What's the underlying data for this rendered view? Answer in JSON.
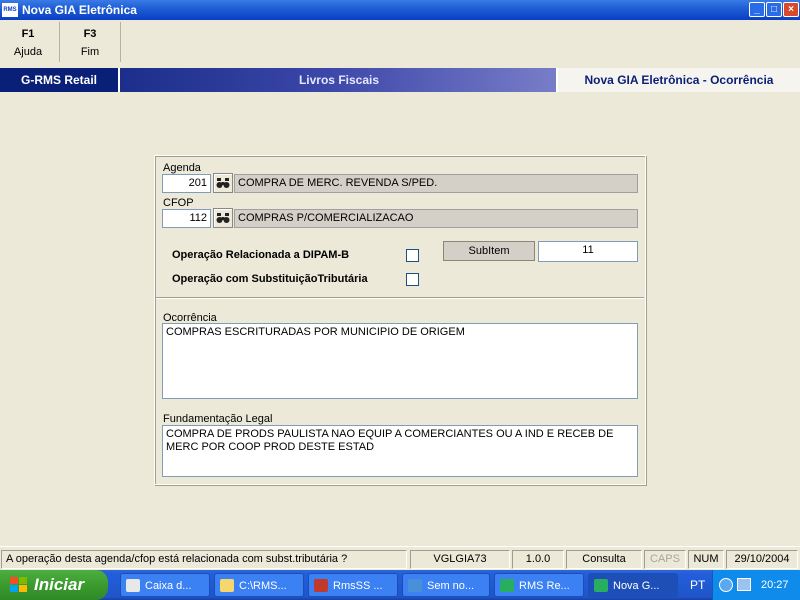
{
  "window": {
    "title": "Nova GIA Eletrônica",
    "icon_text": "RMS",
    "controls": {
      "minimize": "_",
      "maximize": "□",
      "close": "×"
    }
  },
  "toolbar": {
    "keys": [
      {
        "key": "F1",
        "label": "Ajuda"
      },
      {
        "key": "F3",
        "label": "Fim"
      }
    ]
  },
  "header": {
    "left": "G-RMS Retail",
    "center": "Livros Fiscais",
    "right": "Nova GIA Eletrônica - Ocorrência"
  },
  "form": {
    "agenda": {
      "label": "Agenda",
      "code": "201",
      "description": "COMPRA DE MERC. REVENDA S/PED.",
      "icon": "binoculars-icon"
    },
    "cfop": {
      "label": "CFOP",
      "code": "112",
      "description": "COMPRAS P/COMERCIALIZACAO",
      "icon": "binoculars-icon"
    },
    "dipam": {
      "label": "Operação Relacionada a DIPAM-B",
      "checked": false
    },
    "subst": {
      "label": "Operação com SubstituiçãoTributária",
      "checked": false
    },
    "subitem": {
      "label": "SubItem",
      "value": "11"
    },
    "ocorrencia": {
      "label": "Ocorrência",
      "text": "COMPRAS ESCRITURADAS POR MUNICIPIO DE ORIGEM"
    },
    "fundamentacao": {
      "label": "Fundamentação Legal",
      "text": "COMPRA DE PRODS PAULISTA NAO EQUIP A COMERCIANTES OU A IND E RECEB DE\nMERC POR COOP PROD DESTE ESTAD"
    }
  },
  "statusbar": {
    "message": "A operação desta agenda/cfop está relacionada com subst.tributária ?",
    "program": "VGLGIA73",
    "version": "1.0.0",
    "mode": "Consulta",
    "caps": "CAPS",
    "num": "NUM",
    "date": "29/10/2004"
  },
  "taskbar": {
    "start_label": "Iniciar",
    "items": [
      "Caixa d...",
      "C:\\RMS...",
      "RmsSS ...",
      "Sem no...",
      "RMS Re...",
      "Nova G..."
    ],
    "language": "PT",
    "clock": "20:27"
  }
}
